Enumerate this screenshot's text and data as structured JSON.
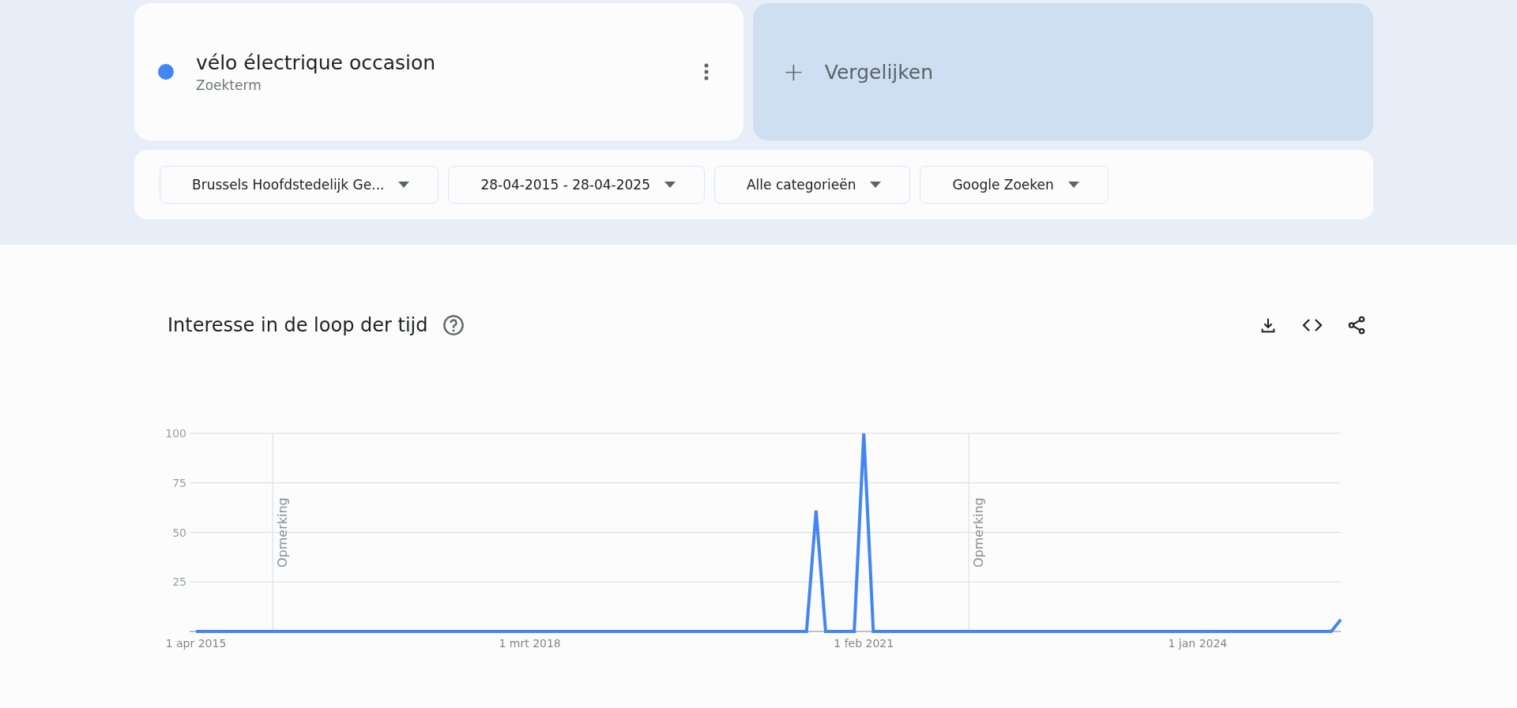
{
  "term": {
    "name": "vélo électrique occasion",
    "type": "Zoekterm",
    "color": "#4285f4"
  },
  "compare": {
    "label": "Vergelijken",
    "icon": "+"
  },
  "filters": [
    {
      "label": "Brussels Hoofdstedelijk Ge..."
    },
    {
      "label": "28-04-2015 - 28-04-2025"
    },
    {
      "label": "Alle categorieën"
    },
    {
      "label": "Google Zoeken"
    }
  ],
  "section": {
    "title": "Interesse in de loop der tijd",
    "chart_data": {
      "type": "line",
      "categories": [
        "1 apr 2015",
        null,
        null,
        null,
        null,
        null,
        null,
        null,
        null,
        null,
        null,
        null,
        null,
        null,
        null,
        null,
        null,
        null,
        null,
        null,
        null,
        null,
        null,
        null,
        null,
        null,
        null,
        null,
        null,
        null,
        null,
        null,
        null,
        null,
        null,
        "1 mrt 2018",
        null,
        null,
        null,
        null,
        null,
        null,
        null,
        null,
        null,
        null,
        null,
        null,
        null,
        null,
        null,
        null,
        null,
        null,
        null,
        null,
        null,
        null,
        null,
        null,
        null,
        null,
        null,
        null,
        null,
        null,
        null,
        null,
        null,
        null,
        "1 feb 2021",
        null,
        null,
        null,
        null,
        null,
        null,
        null,
        null,
        null,
        null,
        null,
        null,
        null,
        null,
        null,
        null,
        null,
        null,
        null,
        null,
        null,
        null,
        null,
        null,
        null,
        null,
        null,
        null,
        null,
        null,
        null,
        null,
        null,
        null,
        "1 jan 2024",
        null,
        null,
        null,
        null,
        null,
        null,
        null,
        null,
        null,
        null,
        null,
        null,
        null,
        null,
        null
      ],
      "series": [
        {
          "color": "#4285f4",
          "values": [
            0,
            0,
            0,
            0,
            0,
            0,
            0,
            0,
            0,
            0,
            0,
            0,
            0,
            0,
            0,
            0,
            0,
            0,
            0,
            0,
            0,
            0,
            0,
            0,
            0,
            0,
            0,
            0,
            0,
            0,
            0,
            0,
            0,
            0,
            0,
            0,
            0,
            0,
            0,
            0,
            0,
            0,
            0,
            0,
            0,
            0,
            0,
            0,
            0,
            0,
            0,
            0,
            0,
            0,
            0,
            0,
            0,
            0,
            0,
            0,
            0,
            0,
            0,
            0,
            0,
            61,
            0,
            0,
            0,
            0,
            100,
            0,
            0,
            0,
            0,
            0,
            0,
            0,
            0,
            0,
            0,
            0,
            0,
            0,
            0,
            0,
            0,
            0,
            0,
            0,
            0,
            0,
            0,
            0,
            0,
            0,
            0,
            0,
            0,
            0,
            0,
            0,
            0,
            0,
            0,
            0,
            0,
            0,
            0,
            0,
            0,
            0,
            0,
            0,
            0,
            0,
            0,
            0,
            0,
            0,
            6
          ]
        }
      ],
      "ylim": [
        0,
        100
      ],
      "grid": true,
      "yticks": [
        {
          "value": 25,
          "label": "25"
        },
        {
          "value": 50,
          "label": "50"
        },
        {
          "value": 75,
          "label": "75"
        },
        {
          "value": 100,
          "label": "100"
        }
      ],
      "annotations": [
        "Opmerking",
        "Opmerking"
      ]
    }
  }
}
